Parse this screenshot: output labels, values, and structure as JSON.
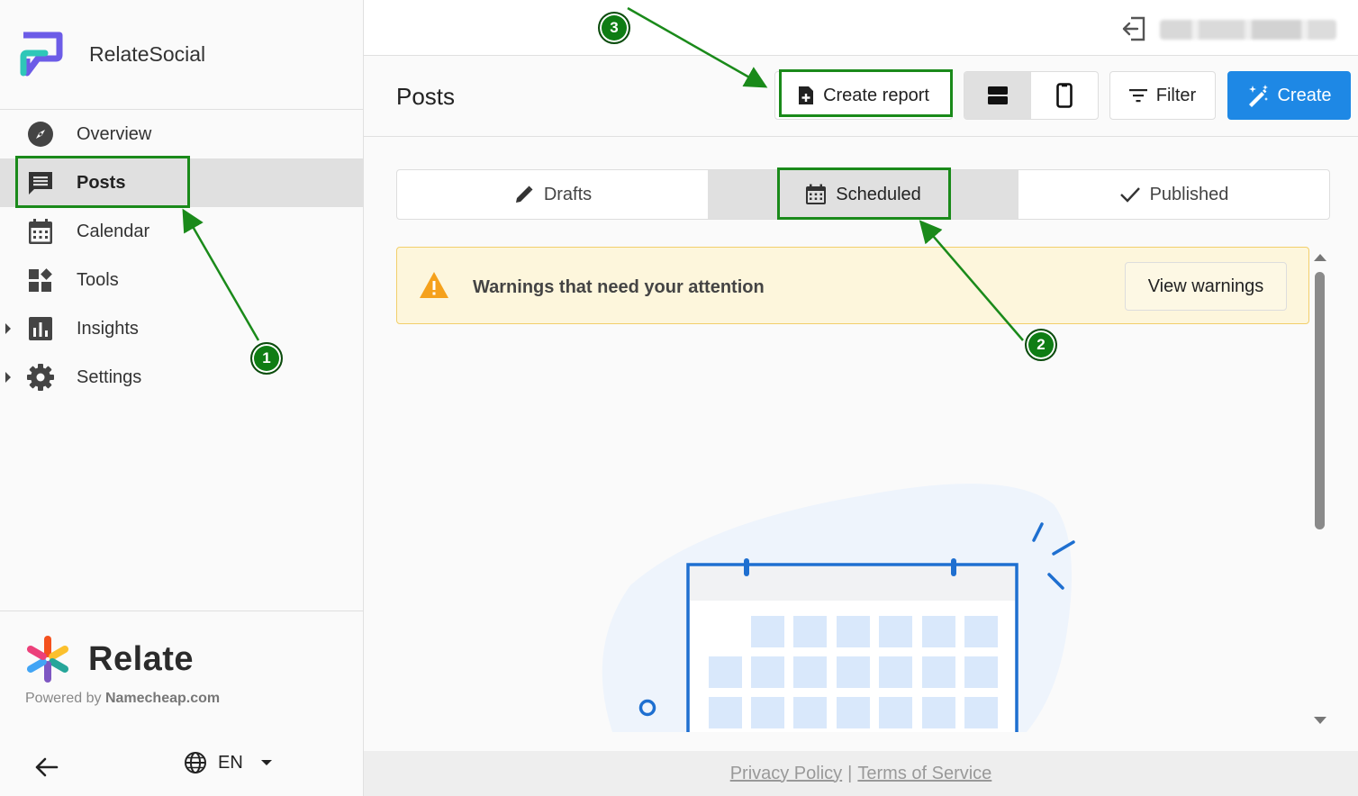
{
  "brand": {
    "name": "RelateSocial"
  },
  "nav": {
    "items": [
      {
        "label": "Overview",
        "icon": "compass-icon"
      },
      {
        "label": "Posts",
        "icon": "chat-icon",
        "active": true
      },
      {
        "label": "Calendar",
        "icon": "calendar-icon"
      },
      {
        "label": "Tools",
        "icon": "tools-icon"
      },
      {
        "label": "Insights",
        "icon": "chart-icon",
        "expandable": true
      },
      {
        "label": "Settings",
        "icon": "gear-icon",
        "expandable": true
      }
    ]
  },
  "footer_brand": {
    "logo_text": "Relate",
    "powered_prefix": "Powered by ",
    "powered_name": "Namecheap.com"
  },
  "language": {
    "current": "EN"
  },
  "header": {
    "title": "Posts",
    "create_report": "Create report",
    "filter": "Filter",
    "create": "Create"
  },
  "tabs": [
    {
      "label": "Drafts",
      "icon": "pencil-icon"
    },
    {
      "label": "Scheduled",
      "icon": "calendar-icon",
      "active": true
    },
    {
      "label": "Published",
      "icon": "check-icon"
    }
  ],
  "warning": {
    "text": "Warnings that need your attention",
    "button": "View warnings"
  },
  "footer": {
    "privacy": "Privacy Policy",
    "separator": "|",
    "terms": "Terms of Service"
  },
  "annotations": {
    "badge1": "1",
    "badge2": "2",
    "badge3": "3"
  },
  "colors": {
    "accent": "#1e88e5",
    "annotation": "#1a8a1a",
    "warning_bg": "#fdf6dc",
    "warning_icon": "#f5a11c"
  }
}
